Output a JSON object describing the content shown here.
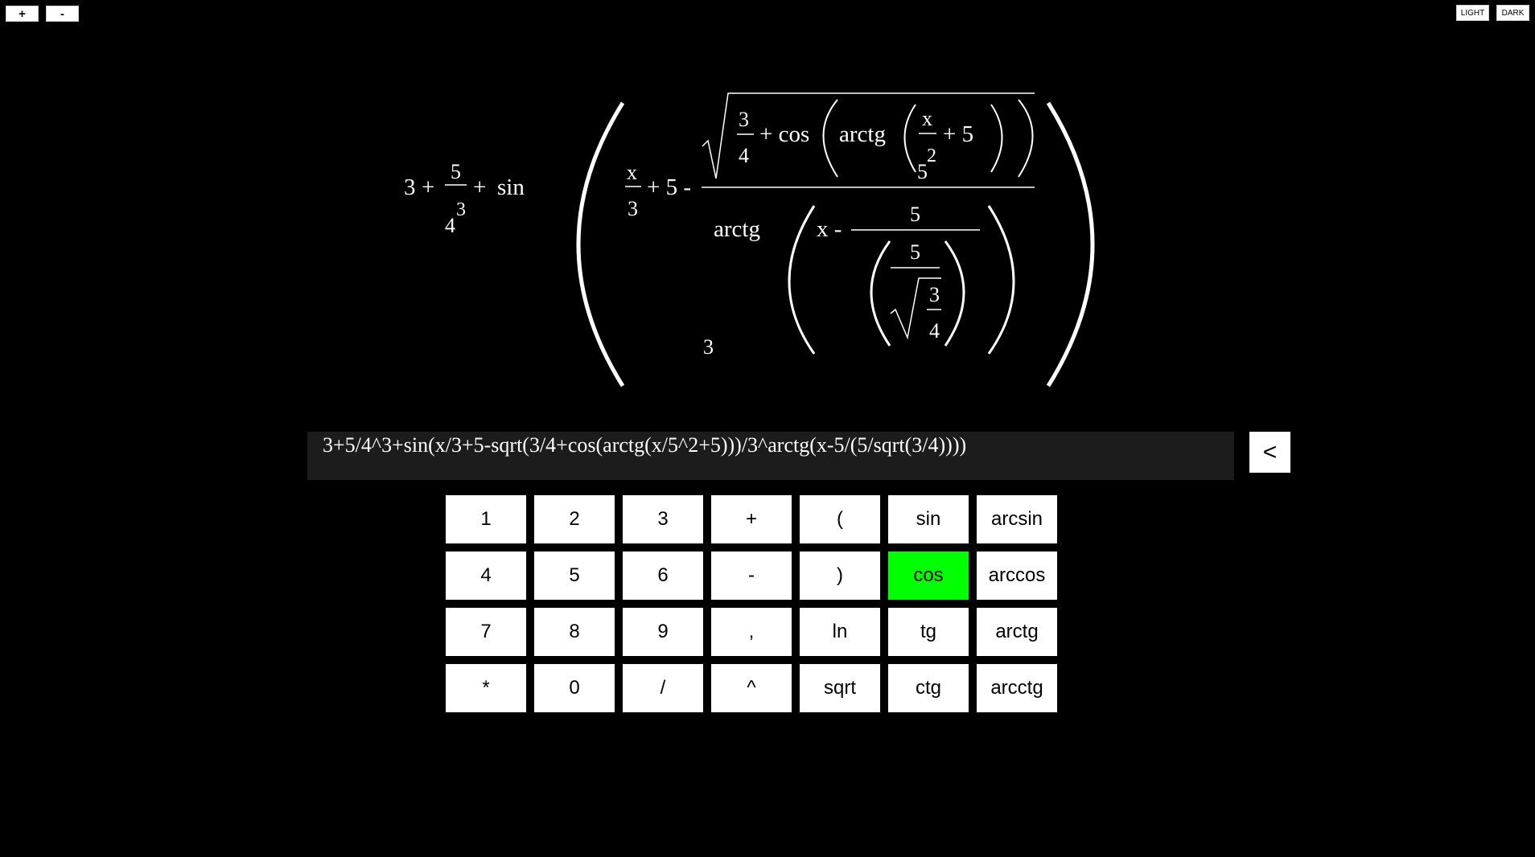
{
  "toolbar": {
    "zoom_in_label": "+",
    "zoom_out_label": "-",
    "light_label": "LIGHT",
    "dark_label": "DARK"
  },
  "formula": {
    "t_3": "3",
    "t_plus1": "+",
    "t_5a": "5",
    "t_4a": "4",
    "t_exp3": "3",
    "t_plus2": "+",
    "t_sin": "sin",
    "t_xa": "x",
    "t_3b": "3",
    "t_plus5": "+ 5 -",
    "t_3c": "3",
    "t_4b": "4",
    "t_pluscos": "+ cos",
    "t_arctg1": "arctg",
    "t_xb": "x",
    "t_5b": "5",
    "t_sq2": "2",
    "t_plus5b": "+ 5",
    "t_arctg2": "arctg",
    "t_base3": "3",
    "t_xminus": "x -",
    "t_5c": "5",
    "t_5d": "5",
    "t_3d": "3",
    "t_4c": "4"
  },
  "input": {
    "value": "3+5/4^3+sin(x/3+5-sqrt(3/4+cos(arctg(x/5^2+5)))/3^arctg(x-5/(5/sqrt(3/4))))"
  },
  "backspace_label": "<",
  "keypad": {
    "rows": [
      [
        "1",
        "2",
        "3",
        "+",
        "(",
        "sin",
        "arcsin"
      ],
      [
        "4",
        "5",
        "6",
        "-",
        ")",
        "cos",
        "arccos"
      ],
      [
        "7",
        "8",
        "9",
        ",",
        "ln",
        "tg",
        "arctg"
      ],
      [
        "*",
        "0",
        "/",
        "^",
        "sqrt",
        "ctg",
        "arcctg"
      ]
    ],
    "active_key": "cos",
    "active_color": "#00ff00"
  }
}
